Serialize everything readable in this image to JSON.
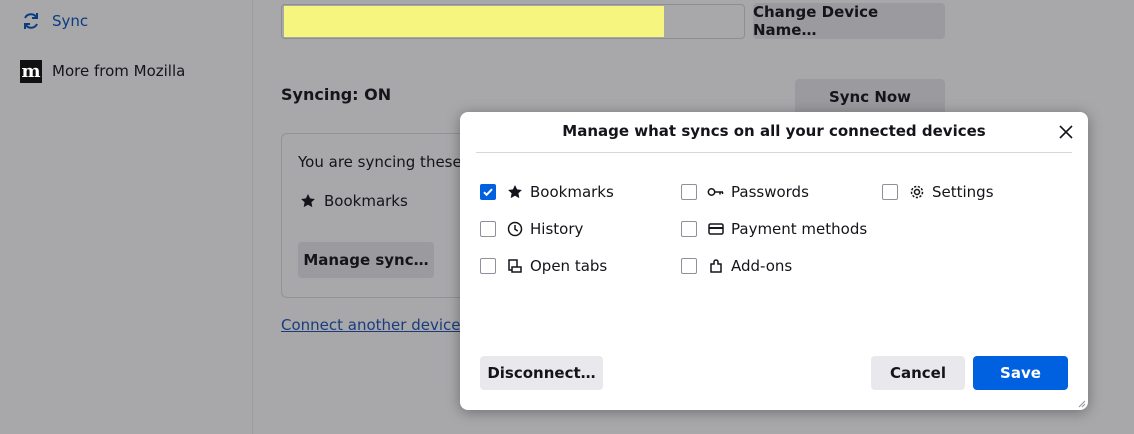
{
  "sidebar": {
    "items": [
      {
        "label": "Sync",
        "icon": "sync-icon"
      },
      {
        "label": "More from Mozilla",
        "icon": "mozilla-logo-icon"
      }
    ]
  },
  "account": {
    "change_device_label": "Change Device Name…"
  },
  "sync_section": {
    "title": "Syncing: ON",
    "sync_now_label": "Sync Now",
    "intro": "You are syncing these ite",
    "synced_items": [
      "Bookmarks"
    ],
    "manage_label": "Manage sync…",
    "connect_link": "Connect another device"
  },
  "dialog": {
    "title": "Manage what syncs on all your connected devices",
    "options": [
      {
        "label": "Bookmarks",
        "checked": true,
        "icon": "star-icon"
      },
      {
        "label": "History",
        "checked": false,
        "icon": "clock-icon"
      },
      {
        "label": "Open tabs",
        "checked": false,
        "icon": "tabs-icon"
      },
      {
        "label": "Passwords",
        "checked": false,
        "icon": "key-icon"
      },
      {
        "label": "Payment methods",
        "checked": false,
        "icon": "credit-card-icon"
      },
      {
        "label": "Add-ons",
        "checked": false,
        "icon": "puzzle-icon"
      },
      {
        "label": "Settings",
        "checked": false,
        "icon": "gear-icon"
      }
    ],
    "disconnect_label": "Disconnect…",
    "cancel_label": "Cancel",
    "save_label": "Save"
  },
  "colors": {
    "accent": "#0061e0",
    "highlight": "#f6f57f",
    "overlay": "#a8a8ab"
  }
}
